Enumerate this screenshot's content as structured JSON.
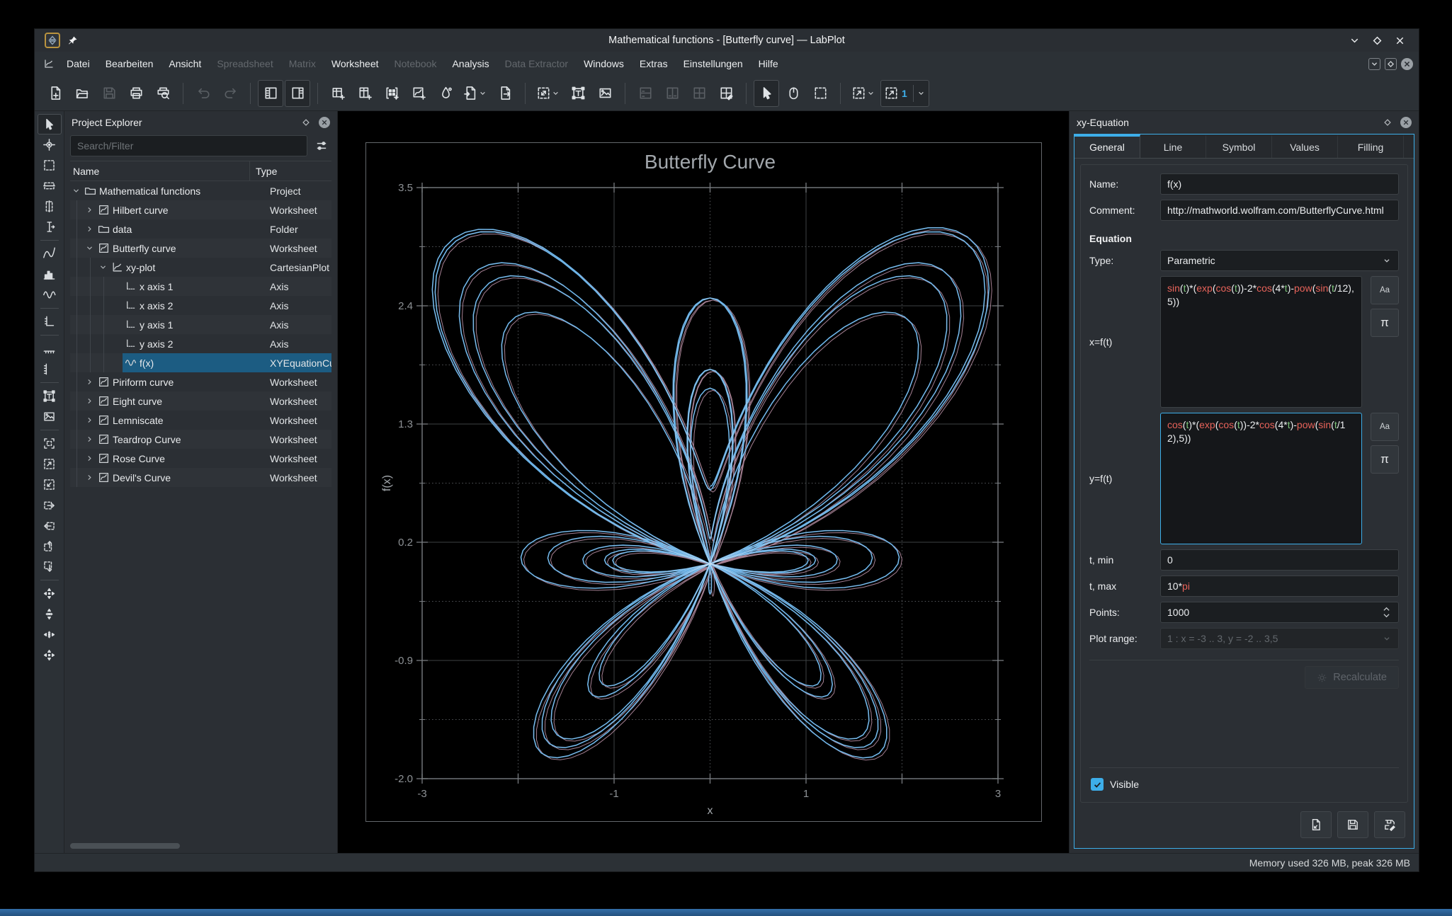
{
  "window": {
    "title": "Mathematical functions - [Butterfly curve] — LabPlot",
    "controls": [
      "minimize",
      "maximize",
      "close"
    ],
    "mdi_controls": [
      "restore",
      "maximize",
      "close"
    ],
    "menu": {
      "items": [
        {
          "label": "Datei",
          "enabled": true
        },
        {
          "label": "Bearbeiten",
          "enabled": true
        },
        {
          "label": "Ansicht",
          "enabled": true
        },
        {
          "label": "Spreadsheet",
          "enabled": false
        },
        {
          "label": "Matrix",
          "enabled": false
        },
        {
          "label": "Worksheet",
          "enabled": true
        },
        {
          "label": "Notebook",
          "enabled": false
        },
        {
          "label": "Analysis",
          "enabled": true
        },
        {
          "label": "Data Extractor",
          "enabled": false
        },
        {
          "label": "Windows",
          "enabled": true
        },
        {
          "label": "Extras",
          "enabled": true
        },
        {
          "label": "Einstellungen",
          "enabled": true
        },
        {
          "label": "Hilfe",
          "enabled": true
        }
      ]
    },
    "toolbar": {
      "zoom_level": "1",
      "groups": [
        [
          {
            "name": "new-project",
            "icon": "document-new"
          },
          {
            "name": "open-project",
            "icon": "document-open"
          },
          {
            "name": "save-project",
            "icon": "document-save",
            "enabled": false
          },
          {
            "name": "print",
            "icon": "document-print"
          },
          {
            "name": "print-preview",
            "icon": "print-preview"
          }
        ],
        [
          {
            "name": "undo",
            "icon": "edit-undo",
            "enabled": false
          },
          {
            "name": "redo",
            "icon": "edit-redo",
            "enabled": false
          }
        ],
        [
          {
            "name": "toggle-project-explorer",
            "icon": "panel-tree",
            "pressed": true
          },
          {
            "name": "toggle-properties-explorer",
            "icon": "panel-list",
            "pressed": true
          }
        ],
        [
          {
            "name": "new-workbook",
            "icon": "workbook-new"
          },
          {
            "name": "new-spreadsheet",
            "icon": "spreadsheet-new"
          },
          {
            "name": "new-matrix",
            "icon": "matrix-new"
          },
          {
            "name": "new-worksheet",
            "icon": "worksheet-new"
          },
          {
            "name": "color-maps",
            "icon": "color-drop"
          },
          {
            "name": "import-data",
            "icon": "import",
            "chevron": true
          },
          {
            "name": "export",
            "icon": "export"
          }
        ],
        [
          {
            "name": "zoom-fit",
            "icon": "zoom-fit",
            "chevron": true
          },
          {
            "name": "add-text-frame",
            "icon": "insert-text"
          },
          {
            "name": "add-image",
            "icon": "insert-image"
          }
        ],
        [
          {
            "name": "vertical-layout",
            "icon": "layout-v",
            "enabled": false
          },
          {
            "name": "horizontal-layout",
            "icon": "layout-h",
            "enabled": false
          },
          {
            "name": "grid-layout",
            "icon": "layout-grid",
            "enabled": false
          },
          {
            "name": "edit-layout",
            "icon": "layout-edit"
          }
        ],
        [
          {
            "name": "select-and-edit",
            "icon": "cursor-arrow",
            "pressed": true
          },
          {
            "name": "navigate",
            "icon": "mouse"
          },
          {
            "name": "select-region",
            "icon": "box-dashed"
          }
        ],
        [
          {
            "name": "magnification",
            "icon": "box-zoom",
            "chevron": true
          },
          {
            "name": "zoom-level",
            "icon": "box-zoom",
            "label": "1",
            "chevron": true,
            "pressed": true
          }
        ]
      ]
    }
  },
  "left_toolbar": {
    "buttons": [
      {
        "name": "select-and-edit",
        "icon": "cursor-arrow",
        "pressed": true
      },
      {
        "name": "crosshair",
        "icon": "crosshair"
      },
      {
        "name": "select-region-and-zoom-in",
        "icon": "box-dashed"
      },
      {
        "name": "select-x-region-and-zoom-in",
        "icon": "box-x"
      },
      {
        "name": "select-y-region-and-zoom-in",
        "icon": "box-y"
      },
      {
        "name": "cursor",
        "icon": "text-cursor"
      },
      {
        "sep": true
      },
      {
        "name": "add-xy-curve",
        "icon": "xy-curve"
      },
      {
        "name": "add-histogram",
        "icon": "histogram"
      },
      {
        "name": "add-equation-curve",
        "icon": "eq-curve"
      },
      {
        "sep": true
      },
      {
        "name": "add-axis",
        "icon": "axis-v"
      },
      {
        "sep": true
      },
      {
        "name": "add-horizontal-axis",
        "icon": "axis-h"
      },
      {
        "name": "add-vertical-axis",
        "icon": "axis-v2"
      },
      {
        "sep": true
      },
      {
        "name": "add-text-label",
        "icon": "insert-text"
      },
      {
        "name": "add-image",
        "icon": "insert-image"
      },
      {
        "sep": true
      },
      {
        "name": "auto-scale",
        "icon": "box-corners"
      },
      {
        "name": "zoom-in-selection",
        "icon": "box-zoom"
      },
      {
        "name": "zoom-out-selection",
        "icon": "box-zoom-out"
      },
      {
        "name": "shift-right-x",
        "icon": "box-right"
      },
      {
        "name": "shift-left-x",
        "icon": "box-left"
      },
      {
        "name": "shift-up-y",
        "icon": "box-up"
      },
      {
        "name": "shift-down-y",
        "icon": "box-down"
      },
      {
        "sep": true
      },
      {
        "name": "auto-scale-all",
        "icon": "cluster"
      },
      {
        "name": "auto-scale-x",
        "icon": "cluster-v"
      },
      {
        "name": "auto-scale-y",
        "icon": "cluster-h"
      },
      {
        "name": "auto-scale-fit",
        "icon": "cluster"
      }
    ]
  },
  "project_explorer": {
    "title": "Project Explorer",
    "search_placeholder": "Search/Filter",
    "columns": [
      "Name",
      "Type"
    ],
    "rows": [
      {
        "indent": 0,
        "expander": "open",
        "icon": "tree-folder",
        "name": "Mathematical functions",
        "type": "Project"
      },
      {
        "indent": 1,
        "expander": "closed",
        "icon": "tree-worksheet",
        "name": "Hilbert curve",
        "type": "Worksheet"
      },
      {
        "indent": 1,
        "expander": "closed",
        "icon": "tree-folder",
        "name": "data",
        "type": "Folder"
      },
      {
        "indent": 1,
        "expander": "open",
        "icon": "tree-worksheet",
        "name": "Butterfly curve",
        "type": "Worksheet"
      },
      {
        "indent": 2,
        "expander": "open",
        "icon": "tree-plot",
        "name": "xy-plot",
        "type": "CartesianPlot"
      },
      {
        "indent": 3,
        "expander": "none",
        "icon": "tree-axis",
        "name": "x axis 1",
        "type": "Axis"
      },
      {
        "indent": 3,
        "expander": "none",
        "icon": "tree-axis",
        "name": "x axis 2",
        "type": "Axis"
      },
      {
        "indent": 3,
        "expander": "none",
        "icon": "tree-axis",
        "name": "y axis 1",
        "type": "Axis"
      },
      {
        "indent": 3,
        "expander": "none",
        "icon": "tree-axis",
        "name": "y axis 2",
        "type": "Axis"
      },
      {
        "indent": 3,
        "expander": "none",
        "icon": "tree-eq",
        "name": "f(x)",
        "type": "XYEquationCurve",
        "selected": true
      },
      {
        "indent": 1,
        "expander": "closed",
        "icon": "tree-worksheet",
        "name": "Piriform curve",
        "type": "Worksheet"
      },
      {
        "indent": 1,
        "expander": "closed",
        "icon": "tree-worksheet",
        "name": "Eight curve",
        "type": "Worksheet"
      },
      {
        "indent": 1,
        "expander": "closed",
        "icon": "tree-worksheet",
        "name": "Lemniscate",
        "type": "Worksheet"
      },
      {
        "indent": 1,
        "expander": "closed",
        "icon": "tree-worksheet",
        "name": "Teardrop Curve",
        "type": "Worksheet"
      },
      {
        "indent": 1,
        "expander": "closed",
        "icon": "tree-worksheet",
        "name": "Rose Curve",
        "type": "Worksheet"
      },
      {
        "indent": 1,
        "expander": "closed",
        "icon": "tree-worksheet",
        "name": "Devil's Curve",
        "type": "Worksheet"
      }
    ]
  },
  "properties": {
    "title": "xy-Equation",
    "tabs": [
      "General",
      "Line",
      "Symbol",
      "Values",
      "Filling"
    ],
    "active_tab": "General",
    "name_label": "Name:",
    "name_value": "f(x)",
    "comment_label": "Comment:",
    "comment_value": "http://mathworld.wolfram.com/ButterflyCurve.html",
    "equation_header": "Equation",
    "type_label": "Type:",
    "type_value": "Parametric",
    "x_label": "x=f(t)",
    "x_formula": "sin(t)*(exp(cos(t))-2*cos(4*t)-pow(sin(t/12), 5))",
    "y_label": "y=f(t)",
    "y_formula": "cos(t)*(exp(cos(t))-2*cos(4*t)-pow(sin(t/12),5))",
    "tmin_label": "t, min",
    "tmin_value": "0",
    "tmax_label": "t, max",
    "tmax_value": "10*pi",
    "points_label": "Points:",
    "points_value": "1000",
    "plot_range_label": "Plot range:",
    "plot_range_value": "1 : x = -3 .. 3, y = -2 .. 3,5",
    "recalculate_label": "Recalculate",
    "visible_label": "Visible",
    "functions_button": "Aa",
    "constants_button": "π"
  },
  "statusbar": {
    "text": "Memory used 326 MB, peak 326 MB"
  },
  "chart_data": {
    "type": "line",
    "title": "Butterfly Curve",
    "xlabel": "x",
    "ylabel": "f(x)",
    "xlim": [
      -3,
      3
    ],
    "ylim": [
      -2,
      3.5
    ],
    "x_ticks": [
      -3,
      -2,
      -1,
      0,
      1,
      2,
      3
    ],
    "x_tick_labels": [
      "-3",
      "-1",
      "1",
      "3"
    ],
    "x_label_positions": [
      -3,
      -1,
      1,
      3
    ],
    "y_tick_labels": [
      "3.5",
      "2.4",
      "1.3",
      "0.2",
      "-0.9",
      "-2.0"
    ],
    "y_label_positions": [
      3.5,
      2.4,
      1.3,
      0.2,
      -0.9,
      -2.0
    ],
    "grid": {
      "major_x": [
        -1,
        1
      ],
      "minor_x": [
        -2,
        0,
        2
      ],
      "major_y": [
        2.4,
        1.3,
        0.2,
        -0.9
      ],
      "minor_y": [
        2.95,
        1.85,
        0.75,
        -0.35,
        -1.45
      ],
      "major_style": "solid",
      "minor_style": "dotted"
    },
    "legend": false,
    "background": "#000000",
    "series": [
      {
        "name": "f(x)",
        "kind": "parametric",
        "x_t": "sin(t)*(exp(cos(t))-2*cos(4*t)-pow(sin(t/12), 5))",
        "y_t": "cos(t)*(exp(cos(t))-2*cos(4*t)-pow(sin(t/12),5))",
        "t_min": "0",
        "t_max": "10*pi",
        "points": 1000,
        "color": "#55a7e2",
        "selection_shadow_color": "#c297ad"
      }
    ]
  }
}
